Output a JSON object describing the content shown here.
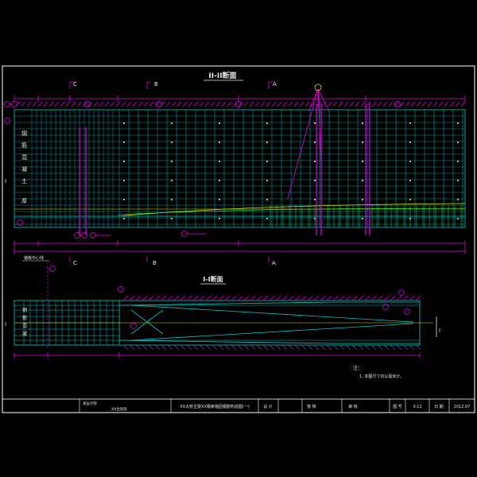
{
  "drawing": {
    "title_section_upper": "II-II断面",
    "title_section_lower": "I-I断面",
    "section_marks": [
      "C",
      "B",
      "A"
    ],
    "section_mark_lower_I": "I",
    "vertical_side_text": [
      "钢",
      "筋",
      "混",
      "凝",
      "土",
      "厚"
    ],
    "left_dim_note": "锚板中心线",
    "note_header": "注：",
    "note_line": "1. 本图尺寸均以毫米计。"
  },
  "titleblock": {
    "company": "某设计院",
    "project": "XX合同段",
    "drawing_name": "XX大桥主梁XX钢束锚固钢筋构造图(一)",
    "design_label": "设 计",
    "check_label": "复 核",
    "review_label": "审 核",
    "number_label": "图 号",
    "number_value": "X-12",
    "date_label": "日 期",
    "date_value": "2012.07"
  },
  "colors": {
    "background": "#000000",
    "frame": "#ffffff",
    "border": "#e400e4",
    "rebar": "#00c8c8",
    "rebar_dark": "#00a0a0",
    "accent": "#ff00ff",
    "yellow": "#e0e000",
    "green": "#00ff40",
    "text": "#e8e8e8"
  }
}
